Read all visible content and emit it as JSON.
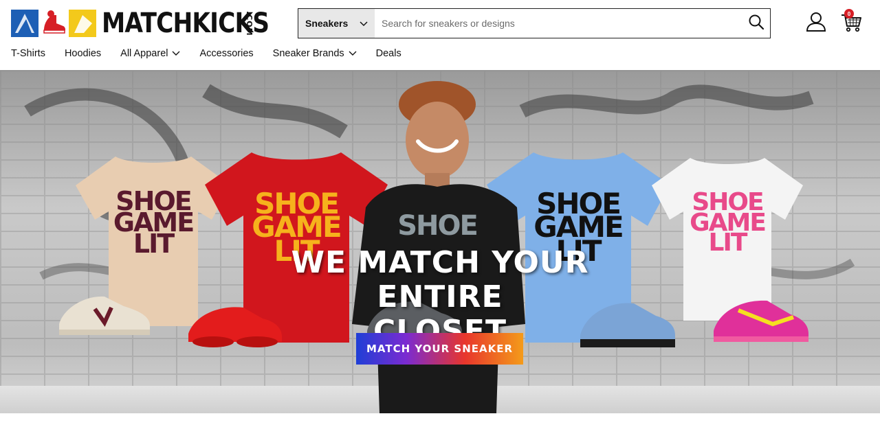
{
  "brand": {
    "name": "MATCHKICKS",
    "suffix": ".COM"
  },
  "search": {
    "category": "Sneakers",
    "placeholder": "Search for sneakers or designs"
  },
  "cart": {
    "count": "0"
  },
  "nav": {
    "items": [
      {
        "label": "T-Shirts"
      },
      {
        "label": "Hoodies"
      },
      {
        "label": "All Apparel"
      },
      {
        "label": "Accessories"
      },
      {
        "label": "Sneaker Brands"
      },
      {
        "label": "Deals"
      }
    ]
  },
  "hero": {
    "title_line1": "WE MATCH YOUR ENTIRE",
    "title_line2": "CLOSET",
    "cta": "MATCH YOUR SNEAKER",
    "shirt_text": "SHOE GAME LIT",
    "shirt_line1": "SHOE",
    "shirt_line2": "GAME",
    "shirt_line3": "LIT"
  },
  "colors": {
    "brand_blue": "#1d5fb5",
    "brand_red": "#d61f26",
    "brand_yellow": "#f3c91b",
    "cart_badge": "#d61f26"
  },
  "icons": {
    "search": "search-icon",
    "account": "user-icon",
    "cart": "cart-icon",
    "chevron": "chevron-down-icon"
  }
}
